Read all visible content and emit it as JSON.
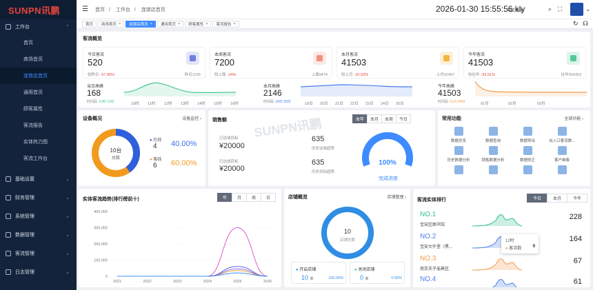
{
  "brand": "SUNPN讯鹏",
  "watermark": "SUNPN讯鹏",
  "sidebar": {
    "groups": [
      {
        "label": "工作台",
        "icon": "monitor-icon",
        "open": true,
        "items": [
          "首页",
          "商场首页",
          "连锁店首页",
          "通用首页",
          "顾客属性",
          "客流报告",
          "实体热力图",
          "客流工作台"
        ]
      },
      {
        "label": "基础设置",
        "icon": "gear-icon"
      },
      {
        "label": "财务管理",
        "icon": "wallet-icon"
      },
      {
        "label": "系统管理",
        "icon": "gear-icon"
      },
      {
        "label": "数据管理",
        "icon": "database-icon"
      },
      {
        "label": "客流管理",
        "icon": "people-icon"
      },
      {
        "label": "日志管理",
        "icon": "log-icon"
      }
    ],
    "active_item": "连锁店首页"
  },
  "breadcrumb": [
    "首页",
    "工作台",
    "连锁店首页"
  ],
  "clock": "2026-01-30 15:55:56",
  "user": "kly",
  "lang": "中文简体",
  "tabs": [
    "首页",
    "商场首页",
    "连锁店首页",
    "通用首页",
    "顾客属性",
    "客流报告"
  ],
  "active_tab": "连锁店首页",
  "overview": {
    "title": "客流概览",
    "cards": [
      {
        "label": "今日客流",
        "value": "520",
        "cmp": "较昨日",
        "pct": "-57.80%",
        "prev": "昨日1235",
        "color": "#6f7fe0"
      },
      {
        "label": "本周客流",
        "value": "7200",
        "cmp": "较上周",
        "pct": "-24%",
        "prev": "上周9474",
        "color": "#f0917e"
      },
      {
        "label": "本月客流",
        "value": "41503",
        "cmp": "较上月",
        "pct": "-20.93%",
        "prev": "上月52487",
        "color": "#f4b63e"
      },
      {
        "label": "今年客流",
        "value": "41503",
        "cmp": "较往年",
        "pct": "-92.51%",
        "prev": "往年554353",
        "color": "#55c69a"
      }
    ],
    "peaks": [
      {
        "label": "当日高峰",
        "value": "168",
        "time_label": "时间段",
        "time": "10时-11时",
        "color": "#4cc68f",
        "ticks": [
          "10时",
          "11时",
          "12时",
          "13时",
          "14时",
          "15时",
          "16时"
        ]
      },
      {
        "label": "本月高峰",
        "value": "2146",
        "time_label": "时间段",
        "time": "19日-25日",
        "color": "#4a7fe8",
        "ticks": [
          "19日",
          "20日",
          "21日",
          "22日",
          "23日",
          "24日",
          "25日"
        ]
      },
      {
        "label": "今年高峰",
        "value": "41503",
        "time_label": "时间段",
        "time": "01日-04日",
        "color": "#f29a4a",
        "ticks": [
          "01月",
          "02月",
          "03月"
        ]
      }
    ]
  },
  "device": {
    "title": "设备概况",
    "link": "设备监控",
    "center": "10台",
    "center_sub": "总数",
    "online_label": "在线",
    "online": "4",
    "online_pct": "40.00%",
    "offline_label": "离线",
    "offline": "6",
    "offline_pct": "60.00%",
    "online_frac": 0.4
  },
  "sales": {
    "title": "销售额",
    "tabs": [
      "本年",
      "本月",
      "本周",
      "今日"
    ],
    "active": "本年",
    "rows": [
      {
        "label": "已达成目标",
        "value": "¥20000",
        "n": "635",
        "n_label": "历史达成趋势"
      },
      {
        "label": "已达成目标",
        "value": "¥20000",
        "n": "635",
        "n_label": "历史目标趋势"
      }
    ],
    "gauge_pct": "100%",
    "gauge_label": "完成进度",
    "gauge_value": 1.0
  },
  "quick": {
    "title": "常用功能",
    "link": "全部功能",
    "items": [
      "数据总览",
      "数据查询",
      "数据导出",
      "出入口客流数...",
      "历史数据分析",
      "销售数据分析",
      "数据修正",
      "客户画像",
      "",
      "",
      "",
      ""
    ]
  },
  "trend": {
    "title": "实体客流趋势(排行榜前十)",
    "tabs": [
      "年",
      "月",
      "周",
      "日"
    ],
    "active": "年"
  },
  "stores": {
    "title": "店铺概览",
    "link": "店铺管理",
    "center": "10",
    "center_sub": "店铺总数",
    "open_label": "开启店铺",
    "open": "10",
    "open_unit": "家",
    "open_pct": "100.00%",
    "closed_label": "关闭店铺",
    "closed": "0",
    "closed_unit": "家",
    "closed_pct": "0.00%"
  },
  "ranking": {
    "title": "客流实体排行",
    "tabs": [
      "今日",
      "本月",
      "今年"
    ],
    "active": "今日",
    "items": [
      {
        "no": "NO.1",
        "name": "宝安区图书馆",
        "value": "228",
        "color": "#2fbf8f"
      },
      {
        "no": "NO.2",
        "name": "宝安大仟里（黑...",
        "value": "164",
        "color": "#4a7fe8"
      },
      {
        "no": "NO.3",
        "name": "南京夫子庙景区",
        "value": "67",
        "color": "#f29a4a"
      },
      {
        "no": "NO.4",
        "name": "",
        "value": "61",
        "color": "#4a7fe8"
      }
    ],
    "tooltip_time": "12时",
    "tooltip_label": "客流数",
    "tooltip_value": "9"
  },
  "chart_data": {
    "type": "line",
    "x": [
      "2021",
      "2022",
      "2023",
      "2024",
      "2025",
      "2026"
    ],
    "ylim": [
      0,
      400000
    ],
    "yticks": [
      "0",
      "100,000",
      "200,000",
      "300,000",
      "400,000"
    ],
    "series": [
      {
        "values": [
          0,
          0,
          0,
          0,
          300000,
          0
        ],
        "color": "#e05ad0"
      },
      {
        "values": [
          0,
          0,
          0,
          0,
          60000,
          0
        ],
        "color": "#5b63e8"
      },
      {
        "values": [
          0,
          0,
          0,
          0,
          45000,
          0
        ],
        "color": "#8c6ce0"
      },
      {
        "values": [
          0,
          0,
          0,
          0,
          35000,
          0
        ],
        "color": "#e6a23c"
      },
      {
        "values": [
          0,
          0,
          0,
          0,
          20000,
          0
        ],
        "color": "#3d8bff"
      }
    ]
  }
}
